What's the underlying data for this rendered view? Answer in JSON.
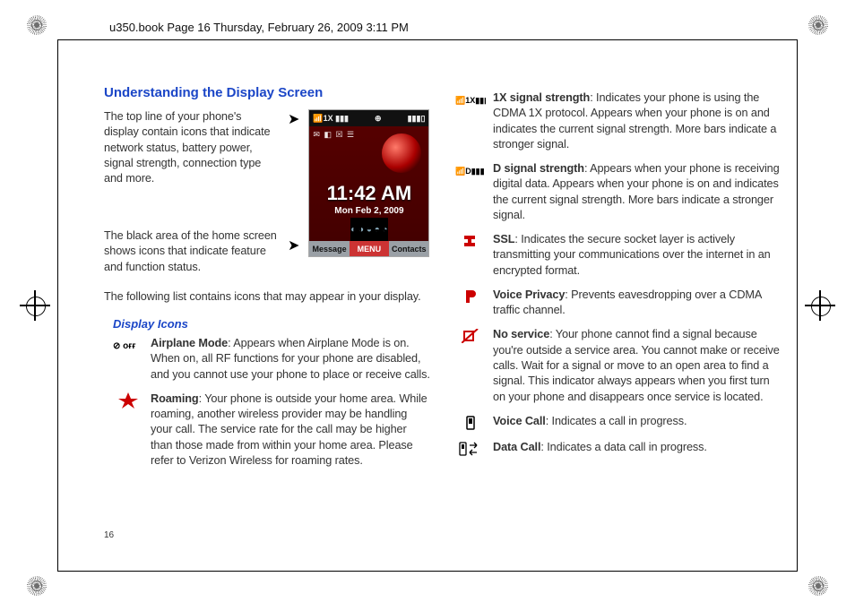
{
  "header": "u350.book  Page 16  Thursday, February 26, 2009  3:11 PM",
  "page_number": "16",
  "title": "Understanding the Display Screen",
  "intro1": "The top line of your phone's display contain icons that indicate network status, battery power, signal strength, connection type and more.",
  "intro2": "The black area of the home screen shows icons that indicate feature and function status.",
  "intro3": "The following list contains icons that may appear in your display.",
  "subheading": "Display Icons",
  "phone": {
    "status_left": "📶1X ▮▮▮",
    "status_mid": "⊕",
    "status_right": "▮▮▮▯",
    "small_icons": "✉ ◧ ☒ ☰",
    "time": "11:42 AM",
    "date": "Mon Feb 2, 2009",
    "soft_left": "Message",
    "soft_mid": "MENU",
    "soft_right": "Contacts"
  },
  "left_icons": [
    {
      "name": "Airplane Mode",
      "desc": ": Appears when Airplane Mode is on. When on, all RF functions for your phone are disabled, and you cannot use your phone to place or receive calls."
    },
    {
      "name": "Roaming",
      "desc": ": Your phone is outside your home area. While roaming, another wireless provider may be handling your call. The service rate for the call may be higher than those made from within your home area. Please refer to Verizon Wireless for roaming rates."
    }
  ],
  "right_icons": [
    {
      "name": "1X signal strength",
      "desc": ": Indicates your phone is using the CDMA 1X protocol. Appears when your phone is on and indicates the current signal strength. More bars indicate a stronger signal."
    },
    {
      "name": "D signal strength",
      "desc": ": Appears when your phone is receiving digital data. Appears when your phone is on and indicates the current signal strength. More bars indicate a stronger signal."
    },
    {
      "name": "SSL",
      "desc": ": Indicates the secure socket layer is actively transmitting your communications over the internet in an encrypted format."
    },
    {
      "name": "Voice Privacy",
      "desc": ": Prevents eavesdropping over a CDMA traffic channel."
    },
    {
      "name": "No service",
      "desc": ": Your phone cannot find a signal because you're outside a service area. You cannot make or receive calls. Wait for a signal or move to an open area to find a signal. This indicator always appears when you first turn on your phone and disappears once service is located."
    },
    {
      "name": "Voice Call",
      "desc": ": Indicates a call in progress."
    },
    {
      "name": "Data Call",
      "desc": ": Indicates a data call in progress."
    }
  ]
}
